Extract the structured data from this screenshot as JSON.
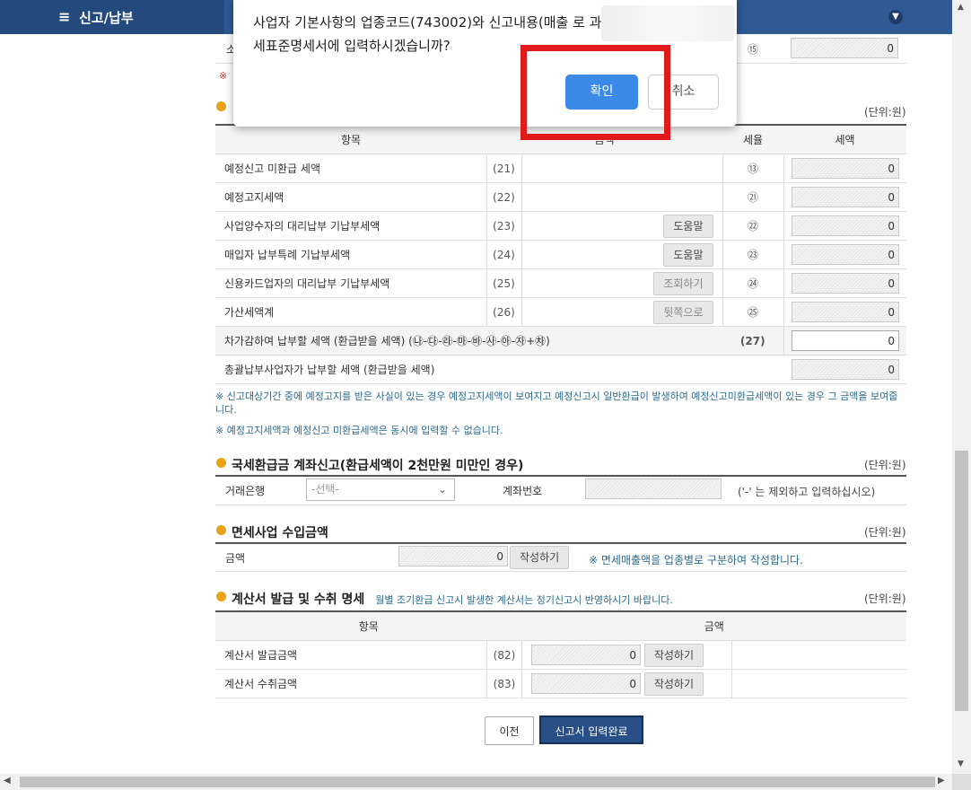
{
  "header": {
    "menu_title": "신고/납부"
  },
  "top_partial_row": {
    "label": "소",
    "rate": "⑮",
    "value": "0",
    "note_mark": "※"
  },
  "dialog": {
    "message": "사업자 기본사항의 업종코드(743002)와 신고내용(매출 로 과세표준명세서에 입력하시겠습니까?",
    "ok_label": "확인",
    "cancel_label": "취소"
  },
  "tax_section": {
    "unit": "(단위:원)",
    "headers": {
      "item": "항목",
      "amount": "금액",
      "rate": "세율",
      "tax": "세액"
    },
    "rows": [
      {
        "name": "예정신고 미환급 세액",
        "num": "(21)",
        "rate": "⑬",
        "value": "0",
        "button": ""
      },
      {
        "name": "예정고지세액",
        "num": "(22)",
        "rate": "㉑",
        "value": "0",
        "button": ""
      },
      {
        "name": "사업양수자의 대리납부 기납부세액",
        "num": "(23)",
        "rate": "㉒",
        "value": "0",
        "button": "도움말"
      },
      {
        "name": "매입자 납부특례 기납부세액",
        "num": "(24)",
        "rate": "㉓",
        "value": "0",
        "button": "도움말"
      },
      {
        "name": "신용카드업자의 대리납부 기납부세액",
        "num": "(25)",
        "rate": "㉔",
        "value": "0",
        "button": "조회하기"
      },
      {
        "name": "가산세액계",
        "num": "(26)",
        "rate": "㉕",
        "value": "0",
        "button": "뒷쪽으로"
      }
    ],
    "subtotal": {
      "name": "차가감하여 납부할 세액 (환급받을 세액) (㉯-㉰-㉱-㉲-㉳-㉴-㉵-㉶+㉷)",
      "num": "(27)",
      "value": "0"
    },
    "total": {
      "name": "총괄납부사업자가 납부할 세액 (환급받을 세액)",
      "value": "0"
    },
    "notes": [
      "※ 신고대상기간 중에 예정고지를 받은 사실이 있는 경우 예정고지세액이 보여지고 예정신고시 일반환급이 발생하여 예정신고미환급세액이 있는 경우 그 금액을 보여줍니다.",
      "※ 예정고지세액과 예정신고 미환급세액은 동시에 입력할 수 없습니다."
    ]
  },
  "refund_section": {
    "title": "국세환급금 계좌신고(환급세액이 2천만원 미만인 경우)",
    "unit": "(단위:원)",
    "bank_label": "거래은행",
    "bank_placeholder": "-선택-",
    "account_label": "계좌번호",
    "account_hint": "('-' 는 제외하고 입력하십시오)"
  },
  "exempt_section": {
    "title": "면세사업 수입금액",
    "unit": "(단위:원)",
    "amount_label": "금액",
    "amount_value": "0",
    "write_button": "작성하기",
    "note": "※ 면세매출액을 업종별로 구분하여 작성합니다."
  },
  "invoice_section": {
    "title": "계산서 발급 및 수취 명세",
    "subtitle": "월별 조기환급 신고시 발생한 계산서는 정기신고시 반영하시기 바랍니다.",
    "unit": "(단위:원)",
    "headers": {
      "item": "항목",
      "amount": "금액"
    },
    "rows": [
      {
        "name": "계산서 발급금액",
        "num": "(82)",
        "value": "0",
        "button": "작성하기"
      },
      {
        "name": "계산서 수취금액",
        "num": "(83)",
        "value": "0",
        "button": "작성하기"
      }
    ]
  },
  "footer": {
    "prev_label": "이전",
    "complete_label": "신고서 입력완료"
  },
  "colors": {
    "accent_blue": "#2f5a94",
    "ok_button": "#3b8ae8",
    "highlight_red": "#e01a1a"
  },
  "icons": [
    "menu-icon",
    "chevron-down-circle-icon",
    "section-bullet-icon",
    "dropdown-chevron-icon"
  ]
}
